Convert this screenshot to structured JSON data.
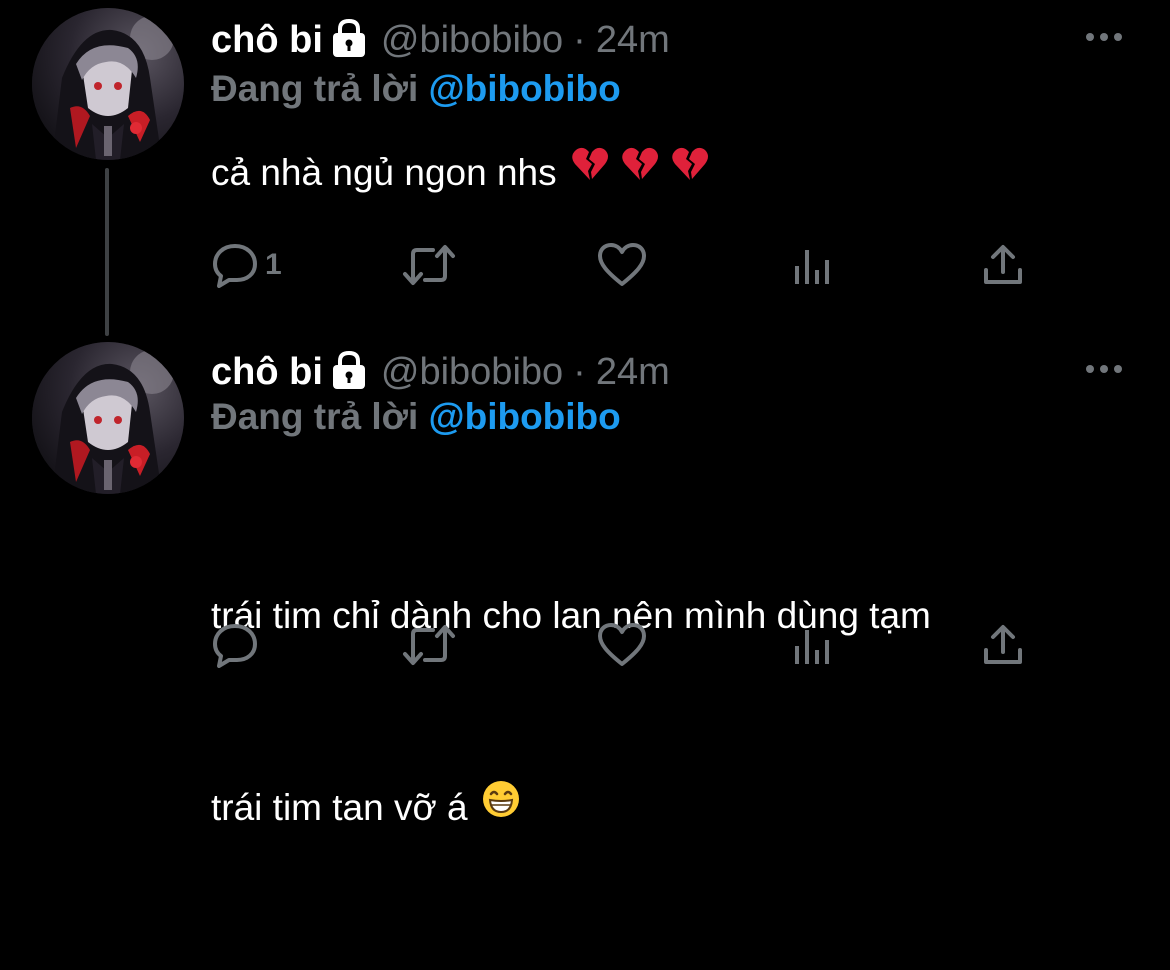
{
  "colors": {
    "background": "#000000",
    "text_primary": "#ffffff",
    "text_secondary": "#71767b",
    "accent": "#1d9bf0",
    "thread_line": "#3e4144"
  },
  "tweets": [
    {
      "author": {
        "display_name": "chô bi",
        "lock_icon": "lock-icon",
        "handle": "@bibobibo",
        "avatar": "anime-character-avatar"
      },
      "separator": "·",
      "timestamp": "24m",
      "replying_to_prefix": "Đang trả lời",
      "replying_to_handle": "@bibobibo",
      "text": "cả nhà ngủ ngon nhs",
      "emojis": [
        "broken-heart-emoji",
        "broken-heart-emoji",
        "broken-heart-emoji"
      ],
      "actions": {
        "reply_count": "1",
        "retweet_count": "",
        "like_count": "",
        "views_count": ""
      }
    },
    {
      "author": {
        "display_name": "chô bi",
        "lock_icon": "lock-icon",
        "handle": "@bibobibo",
        "avatar": "anime-character-avatar"
      },
      "separator": "·",
      "timestamp": "24m",
      "replying_to_prefix": "Đang trả lời",
      "replying_to_handle": "@bibobibo",
      "text_line_1": "trái tim chỉ dành cho lan nên mình dùng tạm",
      "text_line_2": "trái tim tan vỡ á",
      "emojis": [
        "grinning-face-emoji"
      ],
      "actions": {
        "reply_count": "",
        "retweet_count": "",
        "like_count": "",
        "views_count": ""
      }
    }
  ]
}
